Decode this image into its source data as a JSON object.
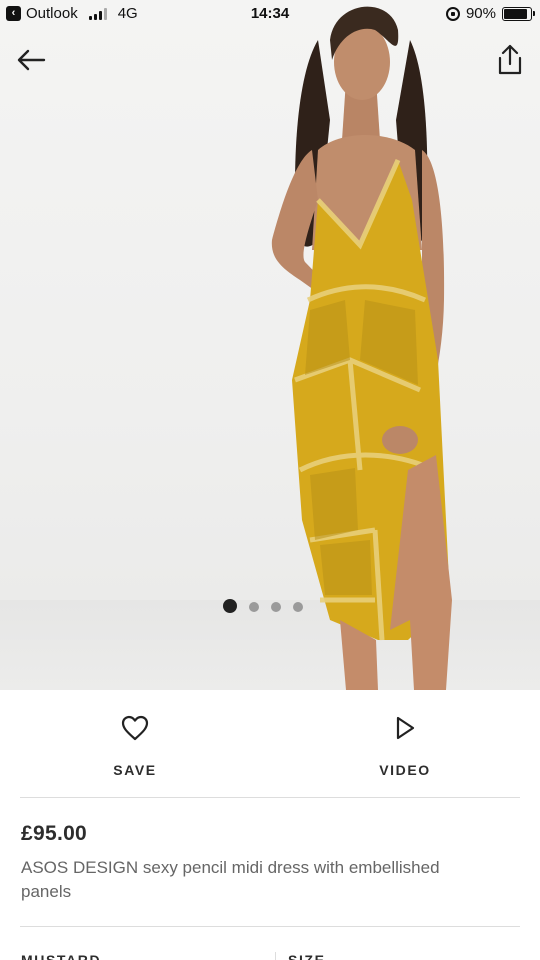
{
  "status_bar": {
    "back_app": "Outlook",
    "network": "4G",
    "time": "14:34",
    "battery": "90%",
    "battery_level": 0.9
  },
  "gallery": {
    "image_alt": "Model wearing mustard embellished pencil midi dress",
    "dot_count": 4,
    "active_dot": 0
  },
  "actions": {
    "save_label": "SAVE",
    "video_label": "VIDEO"
  },
  "product": {
    "price": "£95.00",
    "name": "ASOS DESIGN sexy pencil midi dress with embellished panels"
  },
  "selectors": {
    "colour_label": "MUSTARD",
    "size_label": "SIZE"
  },
  "colors": {
    "dress": "#d6a91c",
    "text": "#2d2d2d",
    "muted": "#666666"
  }
}
